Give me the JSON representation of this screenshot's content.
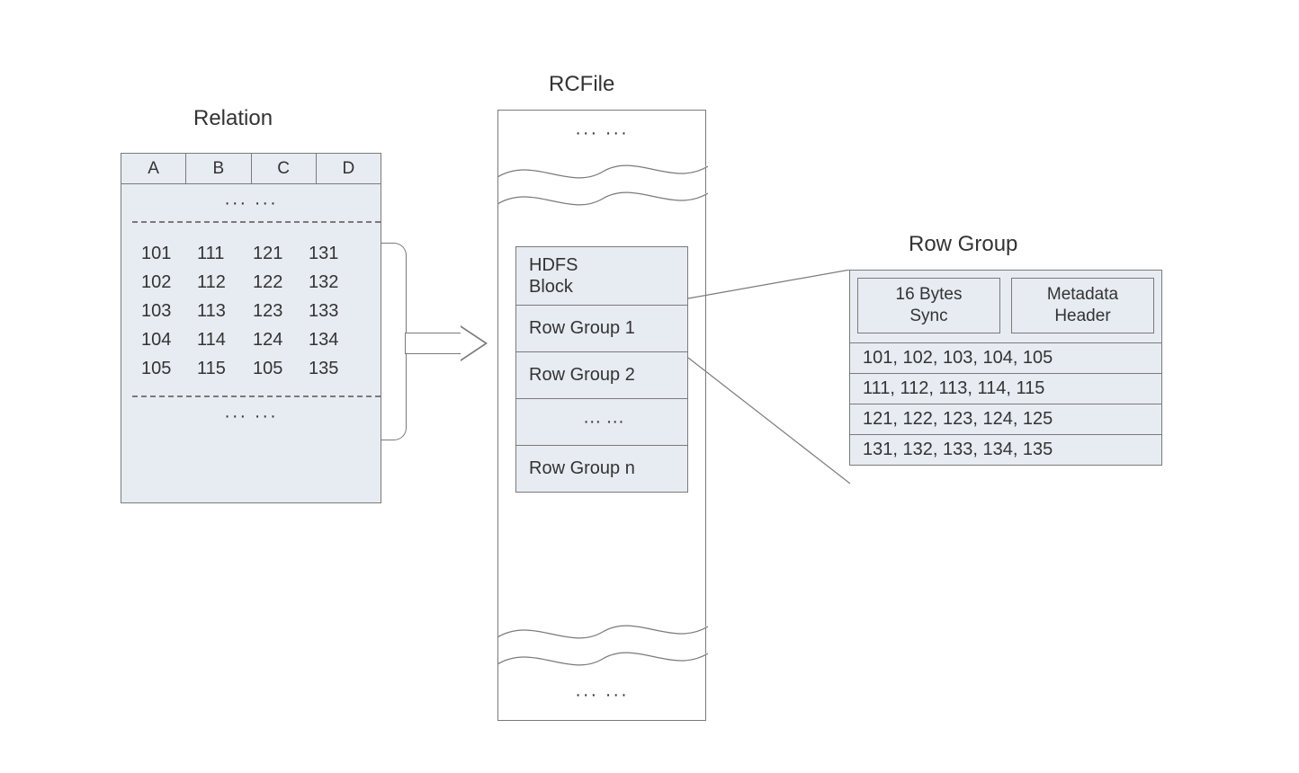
{
  "titles": {
    "relation": "Relation",
    "rcfile": "RCFile",
    "rowgroup": "Row Group"
  },
  "relation": {
    "columns": [
      "A",
      "B",
      "C",
      "D"
    ],
    "ellipsis": "··· ···",
    "rows": [
      [
        "101",
        "111",
        "121",
        "131"
      ],
      [
        "102",
        "112",
        "122",
        "132"
      ],
      [
        "103",
        "113",
        "123",
        "133"
      ],
      [
        "104",
        "114",
        "124",
        "134"
      ],
      [
        "105",
        "115",
        "105",
        "135"
      ]
    ]
  },
  "rcfile": {
    "top_ellipsis": "··· ···",
    "hdfs_block": "HDFS\nBlock",
    "rowgroup1": "Row Group 1",
    "rowgroup2": "Row Group 2",
    "middle_ellipsis": "··· ···",
    "rowgroupn": "Row Group n",
    "bottom_ellipsis": "··· ···"
  },
  "rowgroup_detail": {
    "sync_label": "16 Bytes\nSync",
    "meta_label": "Metadata\nHeader",
    "columns": [
      "101, 102, 103, 104, 105",
      "111, 112, 113, 114, 115",
      "121, 122, 123, 124, 125",
      "131, 132, 133, 134, 135"
    ]
  }
}
